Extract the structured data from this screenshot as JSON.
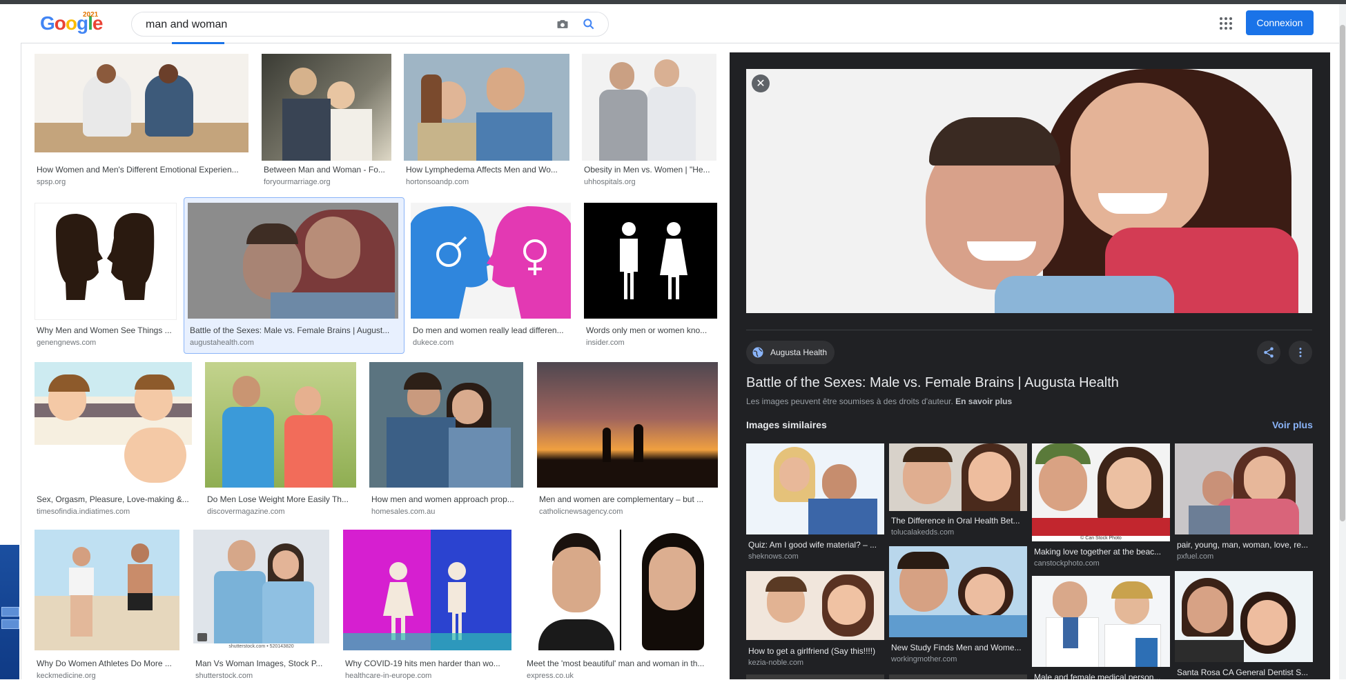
{
  "header": {
    "logo_text": "Google",
    "doodle_year": "2021",
    "search_query": "man and woman",
    "login_label": "Connexion",
    "icons": [
      "camera-icon",
      "search-icon",
      "apps-grid-icon"
    ]
  },
  "results": [
    {
      "title": "How Women and Men's Different Emotional Experien...",
      "source": "spsp.org"
    },
    {
      "title": "Between Man and Woman - Fo...",
      "source": "foryourmarriage.org"
    },
    {
      "title": "How Lymphedema Affects Men and Wo...",
      "source": "hortonsoandp.com"
    },
    {
      "title": "Obesity in Men vs. Women | \"He...",
      "source": "uhhospitals.org"
    },
    {
      "title": "Why Men and Women See Things ...",
      "source": "genengnews.com"
    },
    {
      "title": "Battle of the Sexes: Male vs. Female Brains | August...",
      "source": "augustahealth.com"
    },
    {
      "title": "Do men and women really lead differen...",
      "source": "dukece.com"
    },
    {
      "title": "Words only men or women kno...",
      "source": "insider.com"
    },
    {
      "title": "Sex, Orgasm, Pleasure, Love-making &...",
      "source": "timesofindia.indiatimes.com"
    },
    {
      "title": "Do Men Lose Weight More Easily Th...",
      "source": "discovermagazine.com"
    },
    {
      "title": "How men and women approach prop...",
      "source": "homesales.com.au"
    },
    {
      "title": "Men and women are complementary – but ...",
      "source": "catholicnewsagency.com"
    },
    {
      "title": "Why Do Women Athletes Do More ...",
      "source": "keckmedicine.org"
    },
    {
      "title": "Man Vs Woman Images, Stock P...",
      "source": "shutterstock.com"
    },
    {
      "title": "Why COVID-19 hits men harder than wo...",
      "source": "healthcare-in-europe.com"
    },
    {
      "title": "Meet the 'most beautiful' man and woman in th...",
      "source": "express.co.uk"
    }
  ],
  "thumb_overlays": {
    "shutterstock_caption": "shutterstock.com • 520143820"
  },
  "panel": {
    "site_name": "Augusta Health",
    "title": "Battle of the Sexes: Male vs. Female Brains | Augusta Health",
    "rights_text": "Les images peuvent être soumises à des droits d'auteur.",
    "rights_link": "En savoir plus",
    "similar_heading": "Images similaires",
    "see_more": "Voir plus",
    "similar": [
      {
        "title": "Quiz: Am I good wife material? – ...",
        "source": "sheknows.com"
      },
      {
        "title": "The Difference in Oral Health Bet...",
        "source": "tolucalakedds.com"
      },
      {
        "title": "Making love together at the beac...",
        "source": "canstockphoto.com"
      },
      {
        "title": "pair, young, man, woman, love, re...",
        "source": "pxfuel.com"
      },
      {
        "title": "How to get a girlfriend (Say this!!!!)",
        "source": "kezia-noble.com"
      },
      {
        "title": "New Study Finds Men and Wome...",
        "source": "workingmother.com"
      },
      {
        "title": "Male and female medical person...",
        "source": ""
      },
      {
        "title": "Santa Rosa CA General Dentist S...",
        "source": ""
      }
    ],
    "canstock_caption": "© Can Stock Photo"
  }
}
